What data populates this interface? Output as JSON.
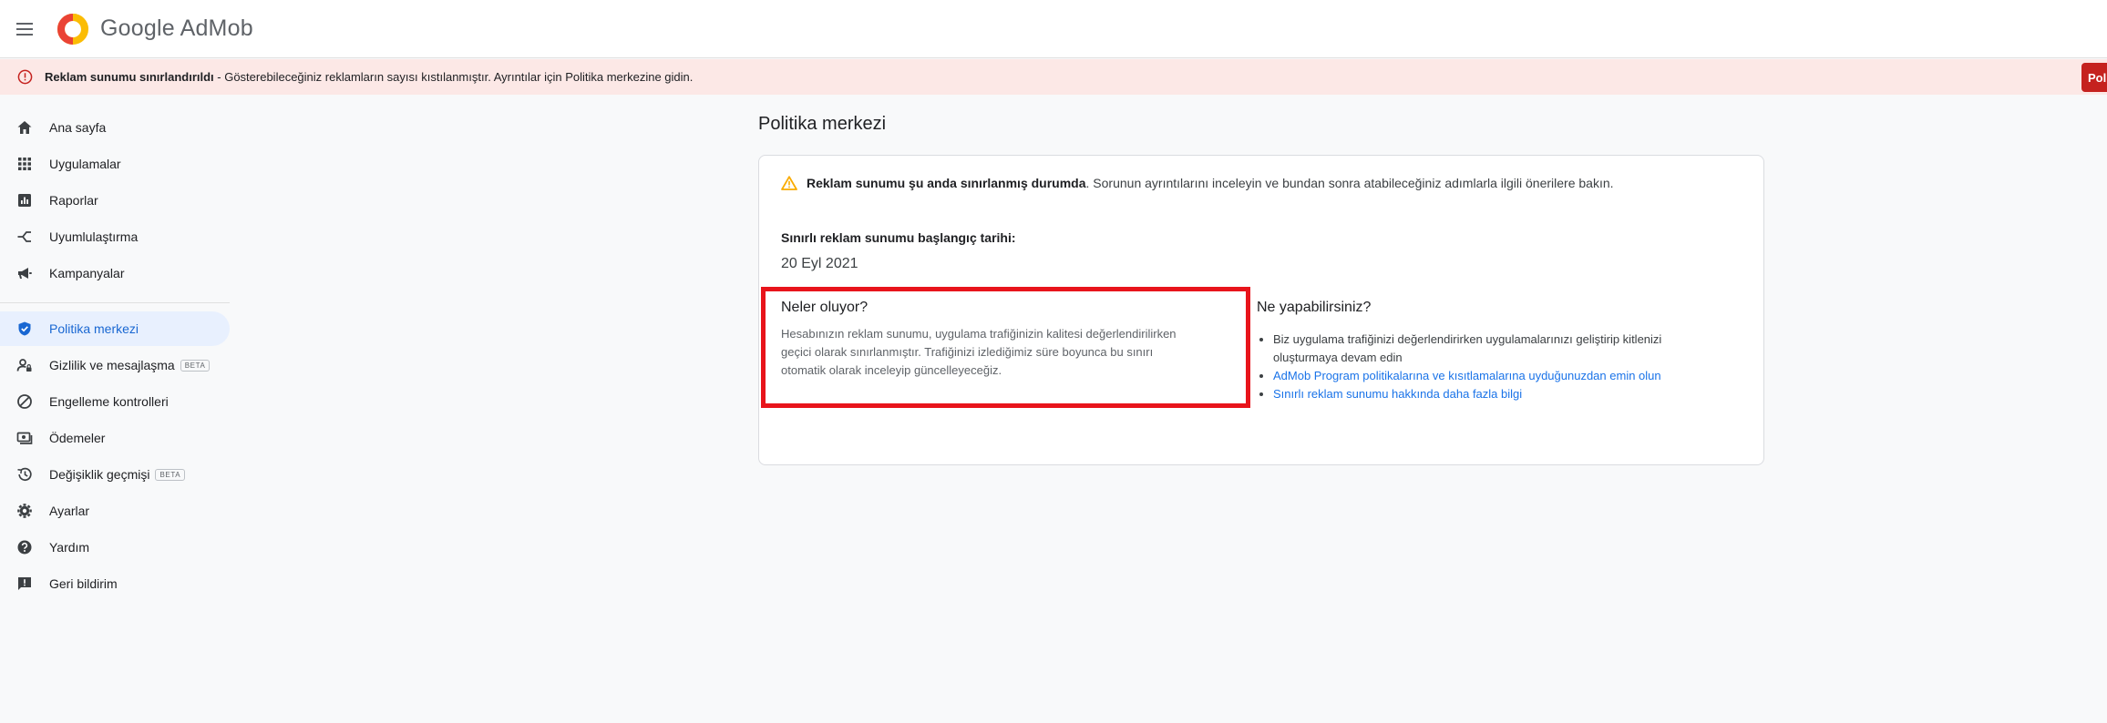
{
  "header": {
    "logo_text": "Google AdMob"
  },
  "alert": {
    "title": "Reklam sunumu sınırlandırıldı",
    "message": " - Gösterebileceğiniz reklamların sayısı kıstılanmıştır. Ayrıntılar için Politika merkezine gidin.",
    "button_label": "Politika"
  },
  "sidebar": {
    "items": [
      {
        "label": "Ana sayfa",
        "icon": "home-icon"
      },
      {
        "label": "Uygulamalar",
        "icon": "apps-grid-icon"
      },
      {
        "label": "Raporlar",
        "icon": "reports-icon"
      },
      {
        "label": "Uyumlulaştırma",
        "icon": "mediation-icon"
      },
      {
        "label": "Kampanyalar",
        "icon": "megaphone-icon"
      },
      {
        "label": "Politika merkezi",
        "icon": "shield-check-icon",
        "active": true
      },
      {
        "label": "Gizlilik ve mesajlaşma",
        "icon": "privacy-icon",
        "badge": "BETA"
      },
      {
        "label": "Engelleme kontrolleri",
        "icon": "block-icon"
      },
      {
        "label": "Ödemeler",
        "icon": "payments-icon"
      },
      {
        "label": "Değişiklik geçmişi",
        "icon": "history-icon",
        "badge": "BETA"
      },
      {
        "label": "Ayarlar",
        "icon": "gear-icon"
      },
      {
        "label": "Yardım",
        "icon": "help-icon"
      },
      {
        "label": "Geri bildirim",
        "icon": "feedback-icon"
      }
    ]
  },
  "main": {
    "page_title": "Politika merkezi",
    "warning_bold": "Reklam sunumu şu anda sınırlanmış durumda",
    "warning_rest": ". Sorunun ayrıntılarını inceleyin ve bundan sonra atabileceğiniz adımlarla ilgili önerilere bakın.",
    "start_label_prefix": "Sınırlı reklam sunumu başlangıç tarihi",
    "start_label_suffix": ":",
    "start_date": "20 Eyl 2021",
    "whats_title": "Neler oluyor?",
    "whats_body": "Hesabınızın reklam sunumu, uygulama trafiğinizin kalitesi değerlendirilirken geçici olarak sınırlanmıştır. Trafiğinizi izlediğimiz süre boyunca bu sınırı otomatik olarak inceleyip güncelleyeceğiz.",
    "todo_title": "Ne yapabilirsiniz?",
    "todo_items": [
      "Biz uygulama trafiğinizi değerlendirirken uygulamalarınızı geliştirip kitlenizi oluşturmaya devam edin",
      "AdMob Program politikalarına ve kısıtlamalarına uyduğunuzdan emin olun",
      "Sınırlı reklam sunumu hakkında daha fazla bilgi"
    ]
  },
  "colors": {
    "brand_blue": "#1a73e8",
    "alert_bg": "#fce8e6",
    "alert_red": "#c5221f",
    "highlight_red": "#e8141b",
    "warning_amber": "#f9ab00"
  }
}
